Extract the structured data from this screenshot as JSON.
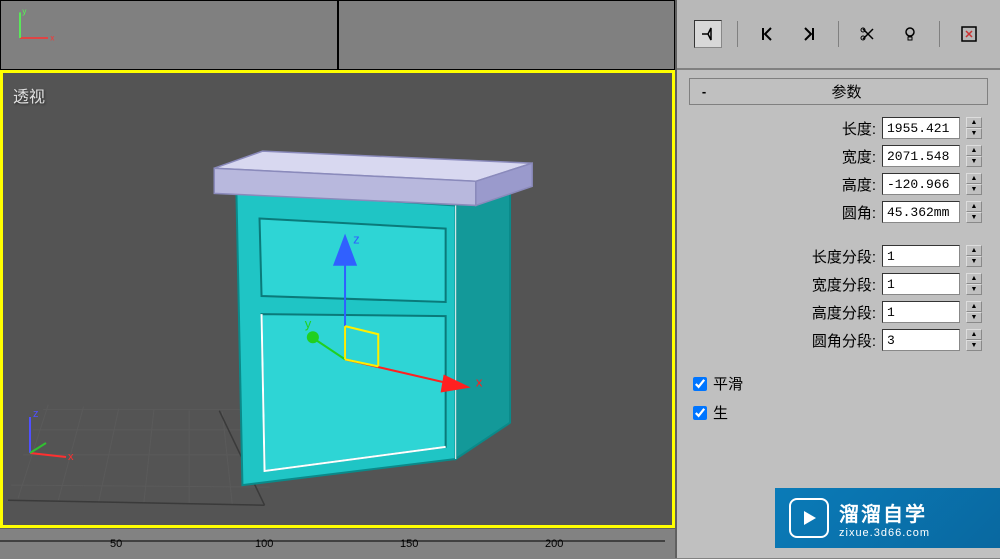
{
  "viewport": {
    "label": "透视"
  },
  "ruler": {
    "ticks": [
      "50",
      "100",
      "150",
      "200"
    ]
  },
  "panel": {
    "section_title": "参数",
    "collapse": "-",
    "params": {
      "length": {
        "label": "长度:",
        "value": "1955.421"
      },
      "width": {
        "label": "宽度:",
        "value": "2071.548"
      },
      "height": {
        "label": "高度:",
        "value": "-120.966"
      },
      "fillet": {
        "label": "圆角:",
        "value": "45.362mm"
      },
      "length_segs": {
        "label": "长度分段:",
        "value": "1"
      },
      "width_segs": {
        "label": "宽度分段:",
        "value": "1"
      },
      "height_segs": {
        "label": "高度分段:",
        "value": "1"
      },
      "fillet_segs": {
        "label": "圆角分段:",
        "value": "3"
      }
    },
    "smooth_label": "平滑",
    "gen_label": "生"
  },
  "watermark": {
    "title": "溜溜自学",
    "url": "zixue.3d66.com"
  },
  "axis": {
    "x": "x",
    "y": "y",
    "z": "z"
  }
}
